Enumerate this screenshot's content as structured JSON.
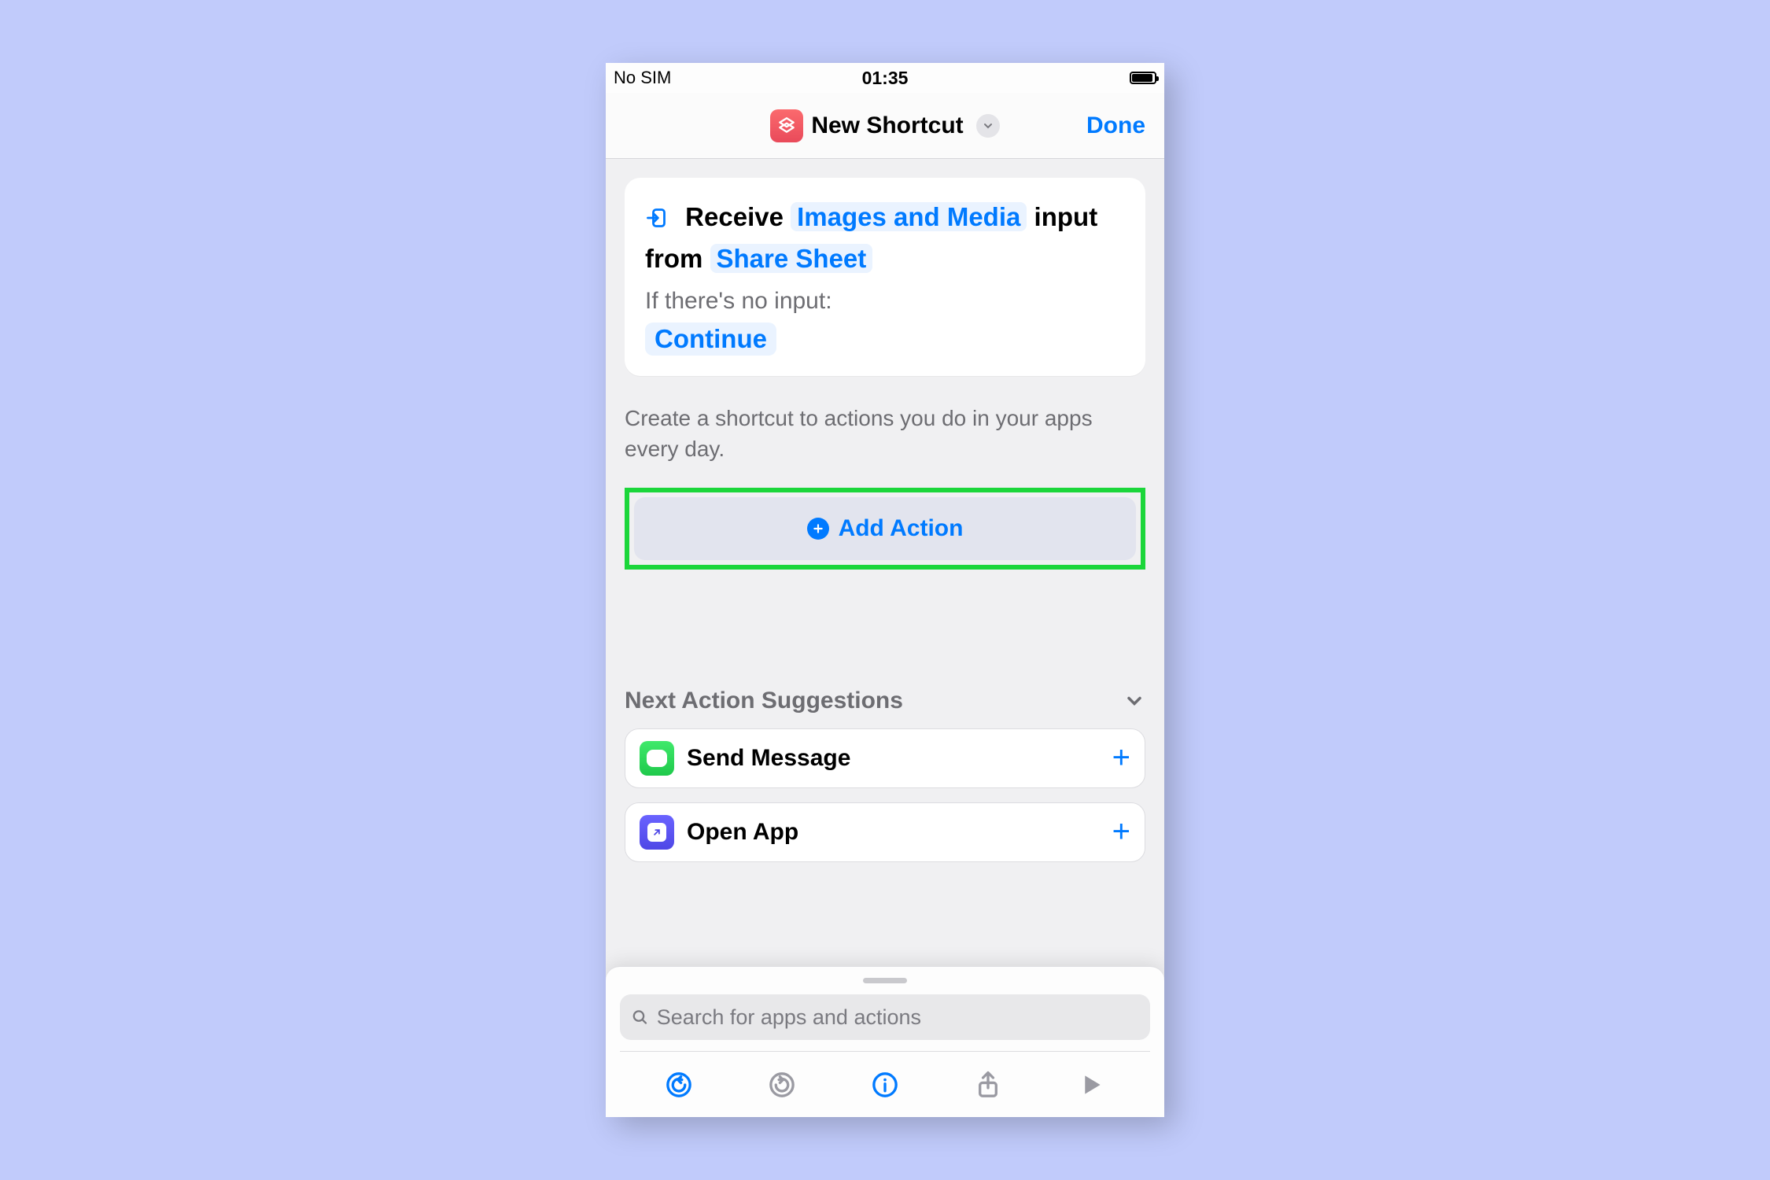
{
  "status_bar": {
    "carrier": "No SIM",
    "time": "01:35"
  },
  "nav": {
    "title": "New Shortcut",
    "done_label": "Done"
  },
  "receive_card": {
    "receive_label": "Receive",
    "input_token": "Images and Media",
    "from_label": "input from",
    "source_token": "Share Sheet",
    "no_input_label": "If there's no input:",
    "fallback_token": "Continue"
  },
  "hint": "Create a shortcut to actions you do in your apps every day.",
  "add_action_label": "Add Action",
  "suggestions": {
    "header": "Next Action Suggestions",
    "items": [
      {
        "label": "Send Message",
        "icon": "messages"
      },
      {
        "label": "Open App",
        "icon": "open-app"
      }
    ]
  },
  "search": {
    "placeholder": "Search for apps and actions"
  },
  "colors": {
    "accent": "#007aff",
    "highlight_border": "#1bd63a"
  }
}
